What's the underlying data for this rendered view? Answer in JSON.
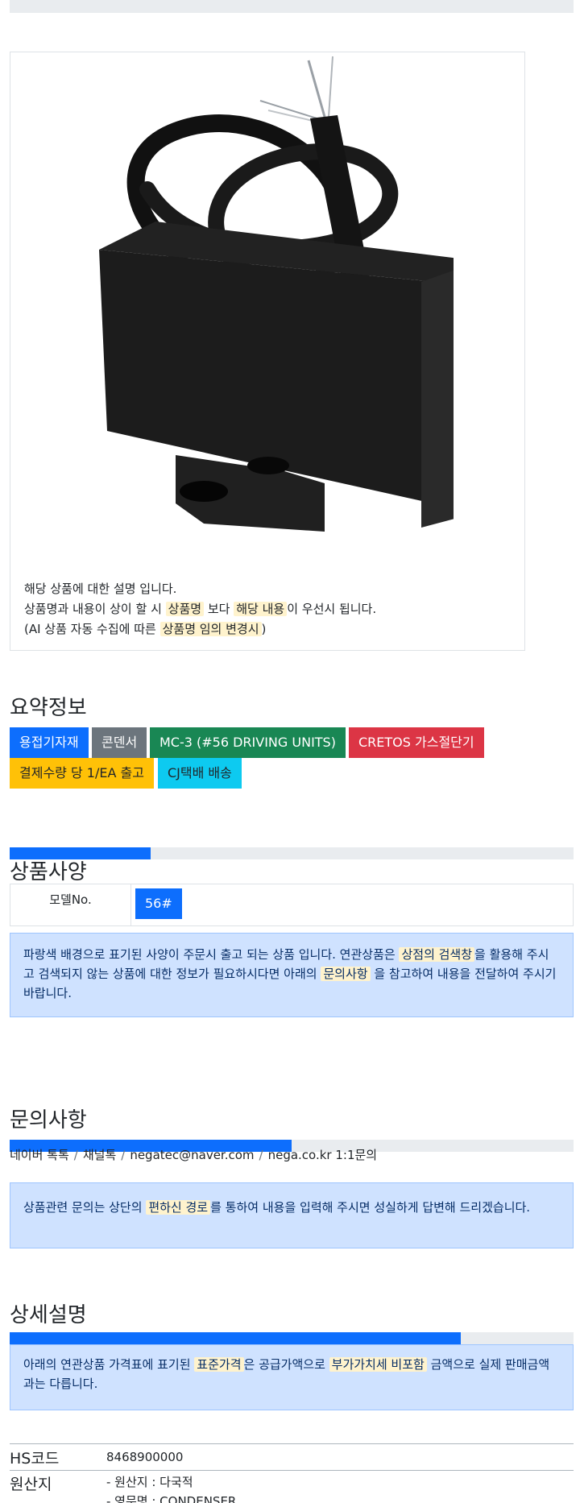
{
  "product": {
    "image_alt": "capacitor-product-photo",
    "description_line1": "해당 상품에 대한 설명 입니다.",
    "line2_part1": "상품명과 내용이 상이 할 시",
    "line2_mark1": "상품명",
    "line2_part2": "보다",
    "line2_mark2": "해당 내용",
    "line2_part3": "이 우선시 됩니다.",
    "line3_part1": "(AI 상품 자동 수집에 따른",
    "line3_mark": "상품명 임의 변경시",
    "line3_part2": ")"
  },
  "summary": {
    "title": "요약정보",
    "badges": [
      {
        "label": "용접기자재",
        "color": "#0d6efd",
        "text_color": "#ffffff"
      },
      {
        "label": "콘덴서",
        "color": "#6c757d",
        "text_color": "#ffffff"
      },
      {
        "label": "MC-3 (#56 DRIVING UNITS)",
        "color": "#198754",
        "text_color": "#ffffff"
      },
      {
        "label": "CRETOS 가스절단기",
        "color": "#dc3545",
        "text_color": "#ffffff"
      },
      {
        "label": "결제수량 당 1/EA 출고",
        "color": "#ffc107",
        "text_color": "#212529"
      },
      {
        "label": "CJ택배 배송",
        "color": "#0dcaf0",
        "text_color": "#212529"
      }
    ]
  },
  "specs": {
    "progress": 0.25,
    "title": "상품사양",
    "model_label": "모델No.",
    "model_value": "56#",
    "alert_part1": "파랑색 배경으로 표기된 사양이 주문시 출고 되는 상품 입니다. 연관상품은",
    "alert_mark1": "상점의 검색창",
    "alert_part2": "을 활용해 주시고 검색되지 않는 상품에 대한 정보가 필요하시다면 아래의",
    "alert_mark2": "문의사항",
    "alert_part3": "을 참고하여 내용을 전달하여 주시기 바랍니다."
  },
  "inquiry": {
    "title": "문의사항",
    "progress": 0.5,
    "channels": [
      "네이버 톡톡",
      "채널톡",
      "negatec@naver.com",
      "nega.co.kr 1:1문의"
    ],
    "separator": "/",
    "alert_part1": "상품관련 문의는 상단의",
    "alert_mark": "편하신 경로",
    "alert_part2": "를 통하여 내용을 입력해 주시면 성실하게 답변해 드리겠습니다."
  },
  "detail": {
    "title": "상세설명",
    "progress": 0.8,
    "alert_part1": "아래의 연관상품 가격표에 표기된",
    "alert_mark1": "표준가격",
    "alert_part2": "은 공급가액으로",
    "alert_mark2": "부가가치세 비포함",
    "alert_part3": "금액으로 실제 판매금액과는 다릅니다."
  },
  "info": {
    "hs_label": "HS코드",
    "hs_value": "8468900000",
    "origin_label": "원산지",
    "origin_line1": "- 원산지 : 다국적",
    "origin_line2": "- 영문명 : CONDENSER"
  }
}
